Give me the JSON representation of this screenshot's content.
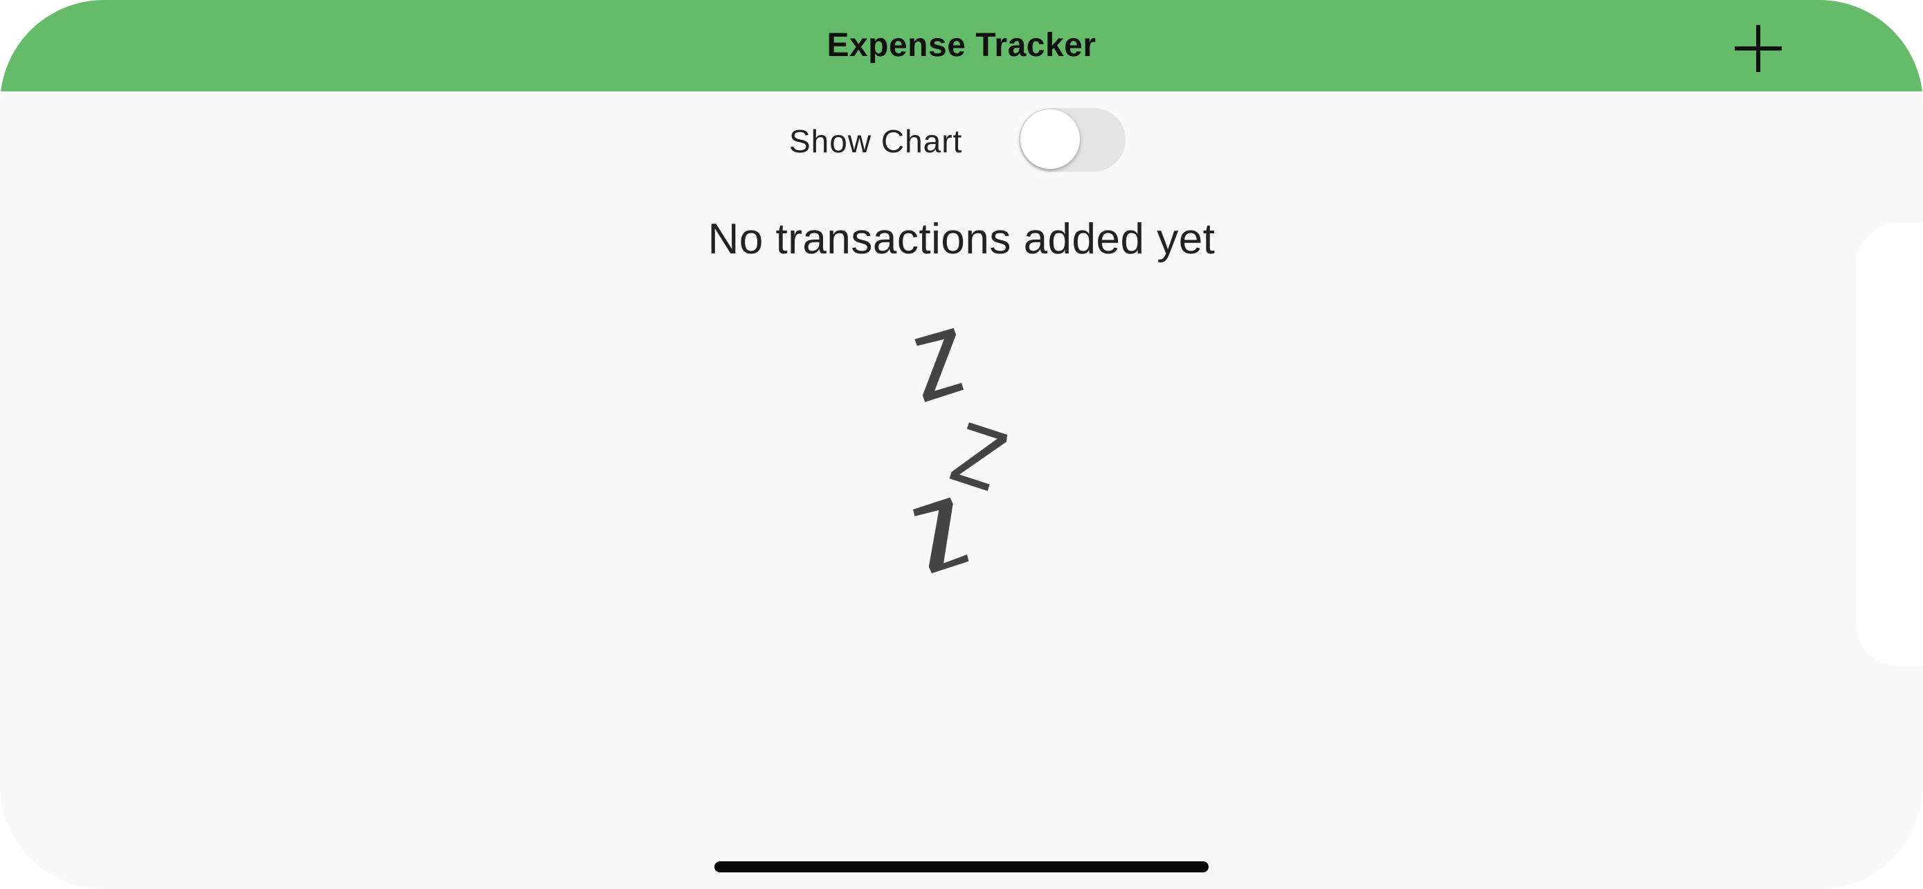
{
  "app_bar": {
    "title": "Expense Tracker",
    "add_icon": "plus-icon",
    "color": "#66bb6a"
  },
  "chart_toggle": {
    "label": "Show Chart",
    "checked": false
  },
  "empty_state": {
    "message": "No transactions added yet",
    "image_icon": "sleeping-zzz-icon"
  },
  "colors": {
    "background": "#f9f9f9",
    "text": "#222222",
    "toggle_track": "#e4e4e4"
  }
}
